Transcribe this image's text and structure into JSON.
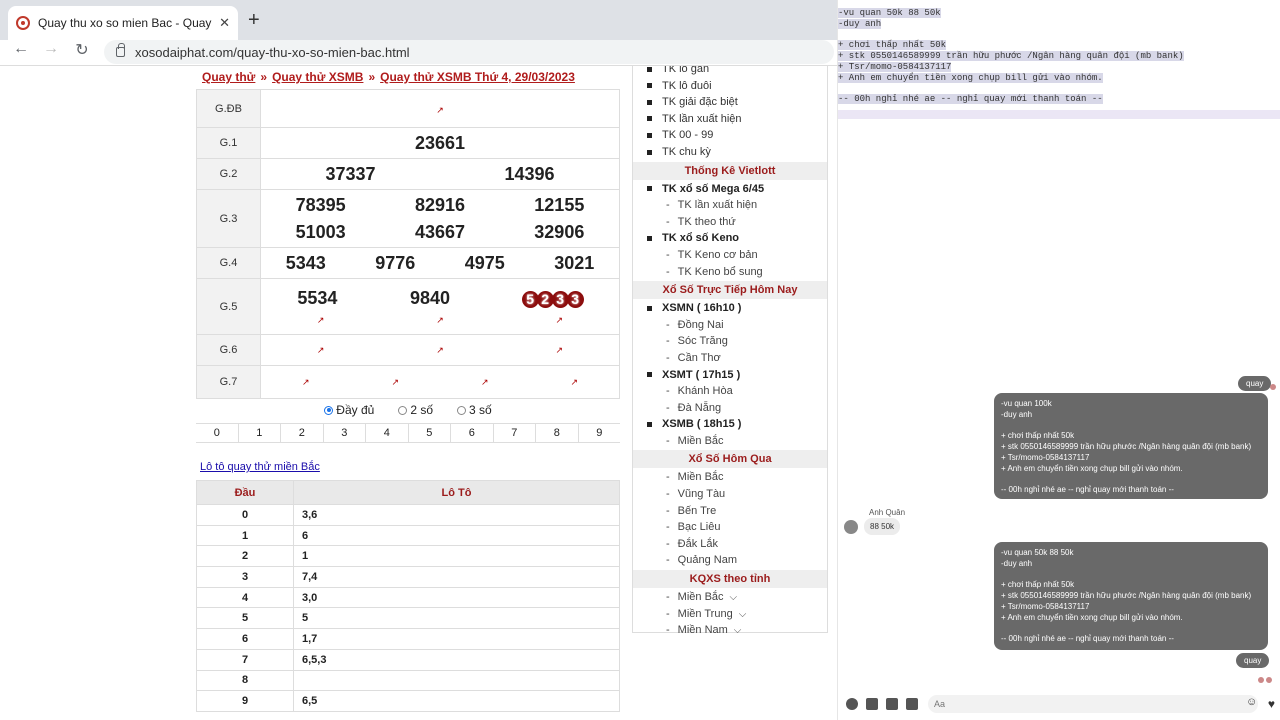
{
  "browser": {
    "tab_title": "Quay thu xo so mien Bac - Quay",
    "url": "xosodaiphat.com/quay-thu-xo-so-mien-bac.html"
  },
  "breadcrumb": [
    "Quay thử",
    "Quay thử XSMB",
    "Quay thử XSMB Thứ 4, 29/03/2023"
  ],
  "results": {
    "gdb_label": "G.ĐB",
    "g1_label": "G.1",
    "g1": [
      "23661"
    ],
    "g2_label": "G.2",
    "g2": [
      "37337",
      "14396"
    ],
    "g3_label": "G.3",
    "g3": [
      "78395",
      "82916",
      "12155",
      "51003",
      "43667",
      "32906"
    ],
    "g4_label": "G.4",
    "g4": [
      "5343",
      "9776",
      "4975",
      "3021"
    ],
    "g5_label": "G.5",
    "g5": [
      "5534",
      "9840",
      "5233"
    ],
    "g6_label": "G.6",
    "g7_label": "G.7"
  },
  "radios": {
    "full": "Đầy đủ",
    "two": "2 số",
    "three": "3 số",
    "selected": "full"
  },
  "digits": [
    "0",
    "1",
    "2",
    "3",
    "4",
    "5",
    "6",
    "7",
    "8",
    "9"
  ],
  "loto": {
    "link": "Lô tô quay thử miền Bắc",
    "head_dau": "Đầu",
    "head_loto": "Lô Tô",
    "rows": [
      {
        "dau": "0",
        "val": "3,6"
      },
      {
        "dau": "1",
        "val": "6"
      },
      {
        "dau": "2",
        "val": "1"
      },
      {
        "dau": "3",
        "val": "7,4"
      },
      {
        "dau": "4",
        "val": "3,0"
      },
      {
        "dau": "5",
        "val": "5"
      },
      {
        "dau": "6",
        "val": "1,7"
      },
      {
        "dau": "7",
        "val": "6,5,3"
      },
      {
        "dau": "8",
        "val": ""
      },
      {
        "dau": "9",
        "val": "6,5"
      }
    ]
  },
  "sidebar": {
    "tk": [
      "TK lô gan",
      "TK lô đuôi",
      "TK giải đặc biệt",
      "TK lần xuất hiện",
      "TK 00 - 99",
      "TK chu kỳ"
    ],
    "vietlott_head": "Thống Kê Vietlott",
    "mega": "TK xổ số Mega 6/45",
    "mega_sub": [
      "TK lần xuất hiện",
      "TK theo thứ"
    ],
    "keno": "TK xổ số Keno",
    "keno_sub": [
      "TK Keno cơ bản",
      "TK Keno bổ sung"
    ],
    "live_head": "Xổ Số Trực Tiếp Hôm Nay",
    "xsmn": "XSMN ( 16h10 )",
    "xsmn_sub": [
      "Đồng Nai",
      "Sóc Trăng",
      "Cần Thơ"
    ],
    "xsmt": "XSMT ( 17h15 )",
    "xsmt_sub": [
      "Khánh Hòa",
      "Đà Nẵng"
    ],
    "xsmb": "XSMB ( 18h15 )",
    "xsmb_sub": [
      "Miền Bắc"
    ],
    "yesterday_head": "Xổ Số Hôm Qua",
    "yesterday": [
      "Miền Bắc",
      "Vũng Tàu",
      "Bến Tre",
      "Bạc Liêu",
      "Đắk Lắk",
      "Quảng Nam"
    ],
    "province_head": "KQXS theo tỉnh",
    "province": [
      "Miền Bắc",
      "Miền Trung",
      "Miền Nam"
    ]
  },
  "chat": {
    "draft": [
      "-vu quan 50k 88 50k",
      "-duy anh",
      "",
      "+ chơi thấp nhất 50k",
      "+ stk  0550146589999 trần hữu phước /Ngân hàng quân đội (mb bank)",
      "+ Tsr/momo-0584137117",
      "+ Anh em chuyển tiền xong chụp bill gửi vào nhóm.",
      "",
      "-- 00h nghỉ nhé ae -- nghỉ quay mới thanh toán --"
    ],
    "msg_quay_1": "quay",
    "msg_1": "-vu quan 100k\n-duy anh\n\n+ chơi thấp nhất 50k\n+ stk  0550146589999 trần hữu phước /Ngân hàng quân đội (mb bank)\n+ Tsr/momo-0584137117\n+ Anh em chuyển tiền xong chụp bill gửi vào nhóm.\n\n-- 00h nghỉ nhé ae -- nghỉ quay mới thanh toán --",
    "incoming_name": "Anh Quân",
    "incoming_msg": "88 50k",
    "msg_2": "-vu quan 50k 88 50k\n-duy anh\n\n+ chơi thấp nhất 50k\n+ stk  0550146589999 trần hữu phước /Ngân hàng quân đội (mb bank)\n+ Tsr/momo-0584137117\n+ Anh em chuyển tiền xong chụp bill gửi vào nhóm.\n\n-- 00h nghỉ nhé ae -- nghỉ quay mới thanh toán --",
    "msg_quay_2": "quay",
    "composer_placeholder": "Aa"
  }
}
